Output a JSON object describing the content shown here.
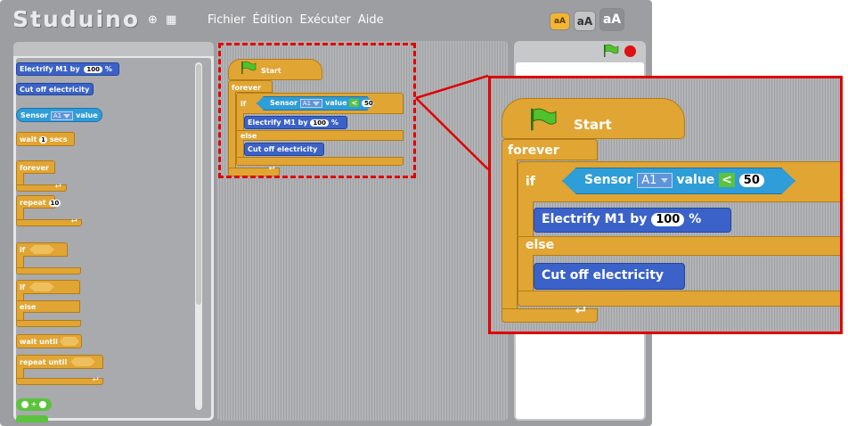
{
  "app": {
    "title": "Studuino"
  },
  "menu": {
    "items": [
      "Fichier",
      "Édition",
      "Exécuter",
      "Aide"
    ]
  },
  "font_size_buttons": [
    "aA",
    "aA",
    "aA"
  ],
  "icons": {
    "globe": "globe-icon",
    "save": "save-icon",
    "green_flag": "green-flag-icon",
    "stop": "stop-icon"
  },
  "colors": {
    "control": "#e1a534",
    "motion": "#3b62c8",
    "sensor": "#2e9dd8",
    "operator": "#5bc33c",
    "highlight": "#e00000"
  },
  "palette": {
    "electrify_label": "Electrify M1 by",
    "electrify_value": "100",
    "percent": "%",
    "cut_off": "Cut off electricity",
    "sensor_label": "Sensor",
    "sensor_port": "A1",
    "sensor_value": "value",
    "wait_label": "wait",
    "wait_value": "1",
    "wait_unit": "secs",
    "forever": "forever",
    "repeat": "repeat",
    "repeat_value": "10",
    "if": "if",
    "if2": "if",
    "else": "else",
    "wait_until": "wait until",
    "repeat_until": "repeat until",
    "plus": "+"
  },
  "script": {
    "start": "Start",
    "forever": "forever",
    "if": "if",
    "sensor_label": "Sensor",
    "sensor_port": "A1",
    "sensor_value": "value",
    "operator": "<",
    "threshold": "50",
    "electrify_label": "Electrify M1 by",
    "electrify_value": "100",
    "percent": "%",
    "else": "else",
    "cut_off": "Cut off electricity"
  }
}
